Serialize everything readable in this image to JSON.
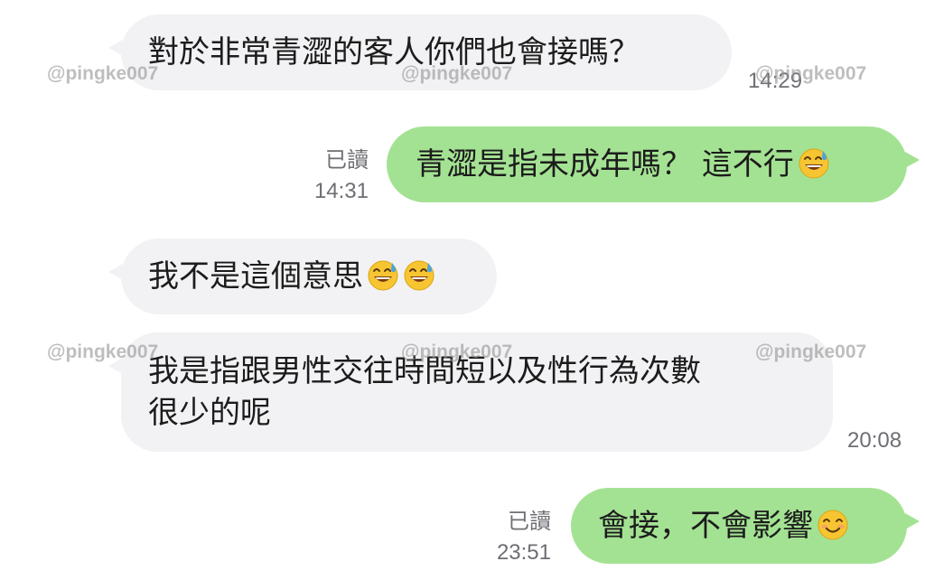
{
  "watermark": "@pingke007",
  "messages": [
    {
      "direction": "incoming",
      "text": "對於非常青澀的客人你們也會接嗎？",
      "time": "14:29",
      "emoji": []
    },
    {
      "direction": "outgoing",
      "text": "青澀是指未成年嗎？ 這不行",
      "read": "已讀",
      "time": "14:31",
      "emoji": [
        "grinning-sweat-face"
      ]
    },
    {
      "direction": "incoming",
      "text": "我不是這個意思",
      "emoji": [
        "grinning-sweat-face",
        "grinning-sweat-face"
      ]
    },
    {
      "direction": "incoming",
      "lines": [
        "我是指跟男性交往時間短以及性行為次數",
        "很少的呢"
      ],
      "time": "20:08",
      "emoji": []
    },
    {
      "direction": "outgoing",
      "text": "會接，不會影響",
      "read": "已讀",
      "time": "23:51",
      "emoji": [
        "smiling-face"
      ]
    }
  ],
  "colors": {
    "incoming_bubble": "#f2f2f4",
    "outgoing_bubble": "#a4e293",
    "meta_text": "#6e6e74",
    "emoji_yellow": "#f7c531",
    "sweat_drop": "#4aa3df"
  }
}
